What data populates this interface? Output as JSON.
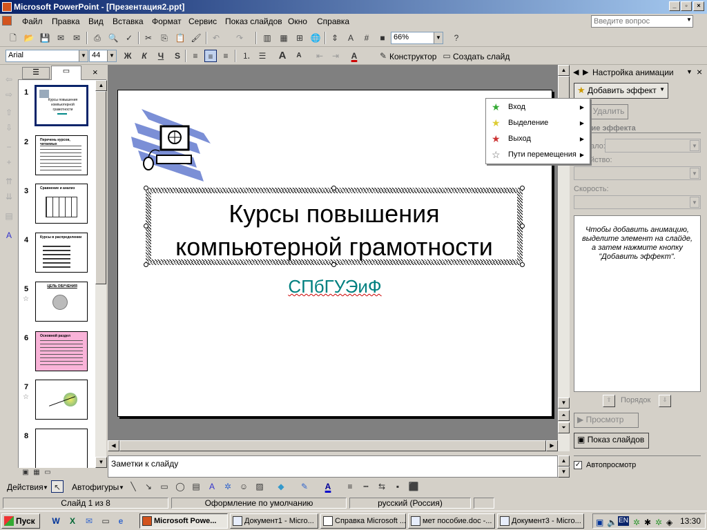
{
  "window": {
    "title": "Microsoft PowerPoint - [Презентация2.ppt]"
  },
  "menu": [
    "Файл",
    "Правка",
    "Вид",
    "Вставка",
    "Формат",
    "Сервис",
    "Показ слайдов",
    "Окно",
    "Справка"
  ],
  "help_placeholder": "Введите вопрос",
  "toolbar": {
    "zoom": "66%",
    "font": "Arial",
    "size": "44",
    "bold": "Ж",
    "italic": "К",
    "underline": "Ч",
    "shadow": "S",
    "design": "Конструктор",
    "new_slide": "Создать слайд"
  },
  "thumbs": [
    {
      "num": "1",
      "title": "Курсы повышения компьютерной грамотности"
    },
    {
      "num": "2",
      "title": "Перечень курсов, читаемых"
    },
    {
      "num": "3",
      "title": "Сравнение и анализ"
    },
    {
      "num": "4",
      "title": "Курсы в распределении"
    },
    {
      "num": "5",
      "title": "ЦЕЛЬ ОБУЧЕНИЯ"
    },
    {
      "num": "6",
      "title": "Основной раздел"
    },
    {
      "num": "7",
      "title": ""
    },
    {
      "num": "8",
      "title": ""
    }
  ],
  "slide": {
    "title": "Курсы повышения компьютерной грамотности",
    "subtitle": "СПбГУЭиФ"
  },
  "notes": "Заметки к слайду",
  "taskpane": {
    "title": "Настройка анимации",
    "add_effect": "Добавить эффект",
    "delete": "Удалить",
    "change_effect": "енение эффекта",
    "start_label": "ало:",
    "prop_label": "йство:",
    "speed_label": "Скорость:",
    "hint": "Чтобы добавить анимацию, выделите элемент на слайде, а затем нажмите кнопку \"Добавить эффект\".",
    "order": "Порядок",
    "preview": "Просмотр",
    "slideshow": "Показ слайдов",
    "autopreview": "Автопросмотр"
  },
  "popup": [
    "Вход",
    "Выделение",
    "Выход",
    "Пути перемещения"
  ],
  "drawbar": {
    "actions": "Действия",
    "autoshapes": "Автофигуры"
  },
  "status": {
    "slide": "Слайд 1 из 8",
    "design": "Оформление по умолчанию",
    "lang": "русский (Россия)"
  },
  "taskbar": {
    "start": "Пуск",
    "tasks": [
      "Microsoft Powe...",
      "Документ1 - Micro...",
      "Справка Microsoft ...",
      "мет пособие.doc -...",
      "Документ3 - Micro..."
    ],
    "lang": "EN",
    "clock": "13:30"
  }
}
